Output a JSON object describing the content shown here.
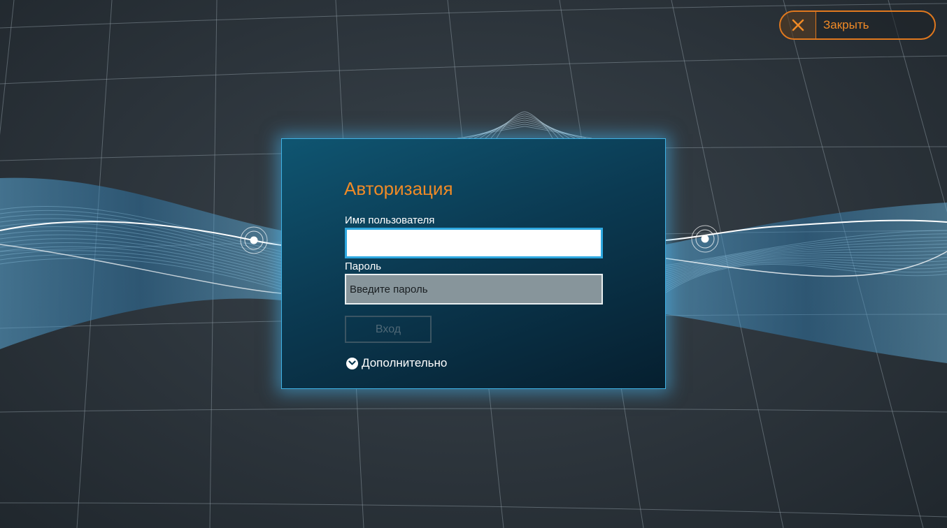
{
  "header": {
    "close_label": "Закрыть",
    "close_icon": "close-x-icon"
  },
  "login": {
    "title": "Авторизация",
    "username_label": "Имя пользователя",
    "username_value": "",
    "password_label": "Пароль",
    "password_placeholder": "Введите пароль",
    "login_button": "Вход",
    "advanced_label": "Дополнительно",
    "advanced_icon": "chevron-down-circle-icon"
  },
  "colors": {
    "accent": "#f08a26",
    "panel_border": "#3fb3e6",
    "input_focus": "#2ea8e0"
  }
}
